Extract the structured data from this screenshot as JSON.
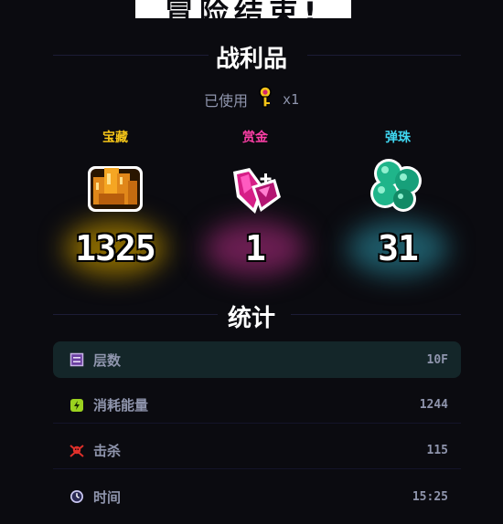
{
  "banner": {
    "title": "冒险结束!"
  },
  "loot": {
    "title": "战利品",
    "used_label": "已使用",
    "used_item_icon": "golden-key-amulet-icon",
    "used_qty": "x1",
    "rewards": [
      {
        "label": "宝藏",
        "value": "1325",
        "color": "#f5c518",
        "glow": "#8a6a00",
        "icon": "treasure-gold-icon"
      },
      {
        "label": "赏金",
        "value": "1",
        "color": "#ff3fa8",
        "glow": "#6b1e52",
        "icon": "bounty-gem-icon"
      },
      {
        "label": "弹珠",
        "value": "31",
        "color": "#3fd6f0",
        "glow": "#1e5a68",
        "icon": "marbles-icon"
      }
    ]
  },
  "stats": {
    "title": "统计",
    "rows": [
      {
        "label": "层数",
        "value": "10F",
        "icon": "floor-layers-icon"
      },
      {
        "label": "消耗能量",
        "value": "1244",
        "icon": "energy-icon"
      },
      {
        "label": "击杀",
        "value": "115",
        "icon": "skull-crossbones-icon"
      },
      {
        "label": "时间",
        "value": "15:25",
        "icon": "clock-icon"
      }
    ]
  }
}
